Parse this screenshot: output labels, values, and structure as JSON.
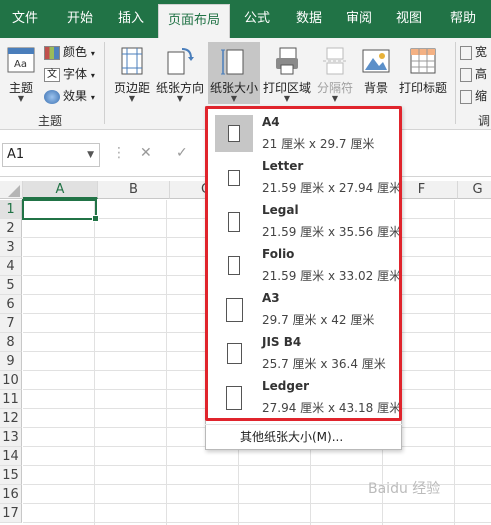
{
  "tabs": [
    {
      "label": "文件",
      "active": false
    },
    {
      "label": "开始",
      "active": false
    },
    {
      "label": "插入",
      "active": false
    },
    {
      "label": "页面布局",
      "active": true
    },
    {
      "label": "公式",
      "active": false
    },
    {
      "label": "数据",
      "active": false
    },
    {
      "label": "审阅",
      "active": false
    },
    {
      "label": "视图",
      "active": false
    },
    {
      "label": "帮助",
      "active": false
    }
  ],
  "ribbon": {
    "themes_label": "主题",
    "colors_label": "颜色",
    "fonts_label": "字体",
    "effects_label": "效果",
    "group_themes": "主题",
    "margins_label": "页边距",
    "orientation_label": "纸张方向",
    "size_label": "纸张大小",
    "print_area_label": "打印区域",
    "breaks_label": "分隔符",
    "background_label": "背景",
    "print_titles_label": "打印标题",
    "right_partial_1": "宽",
    "right_partial_2": "高",
    "right_partial_3": "缩",
    "right_group_partial": "调"
  },
  "formula_bar": {
    "name_box": "A1",
    "cancel_symbol": "✕",
    "enter_symbol": "✓"
  },
  "grid": {
    "columns": [
      "A",
      "B",
      "C",
      "D",
      "E",
      "F",
      "G"
    ],
    "rows": [
      "1",
      "2",
      "3",
      "4",
      "5",
      "6",
      "7",
      "8",
      "9",
      "10",
      "11",
      "12",
      "13",
      "14",
      "15",
      "16",
      "17"
    ]
  },
  "paper_size_menu": {
    "items": [
      {
        "name": "A4",
        "dims": "21 厘米 x 29.7 厘米",
        "selected": true
      },
      {
        "name": "Letter",
        "dims": "21.59 厘米 x 27.94 厘米",
        "selected": false
      },
      {
        "name": "Legal",
        "dims": "21.59 厘米 x 35.56 厘米",
        "selected": false
      },
      {
        "name": "Folio",
        "dims": "21.59 厘米 x 33.02 厘米",
        "selected": false
      },
      {
        "name": "A3",
        "dims": "29.7 厘米 x 42 厘米",
        "selected": false
      },
      {
        "name": "JIS B4",
        "dims": "25.7 厘米 x 36.4 厘米",
        "selected": false
      },
      {
        "name": "Ledger",
        "dims": "27.94 厘米 x 43.18 厘米",
        "selected": false
      }
    ],
    "more_label": "其他纸张大小(M)..."
  },
  "watermark": "Baidu 经验",
  "colors": {
    "brand_green": "#217346",
    "highlight_red": "#e0242c"
  }
}
